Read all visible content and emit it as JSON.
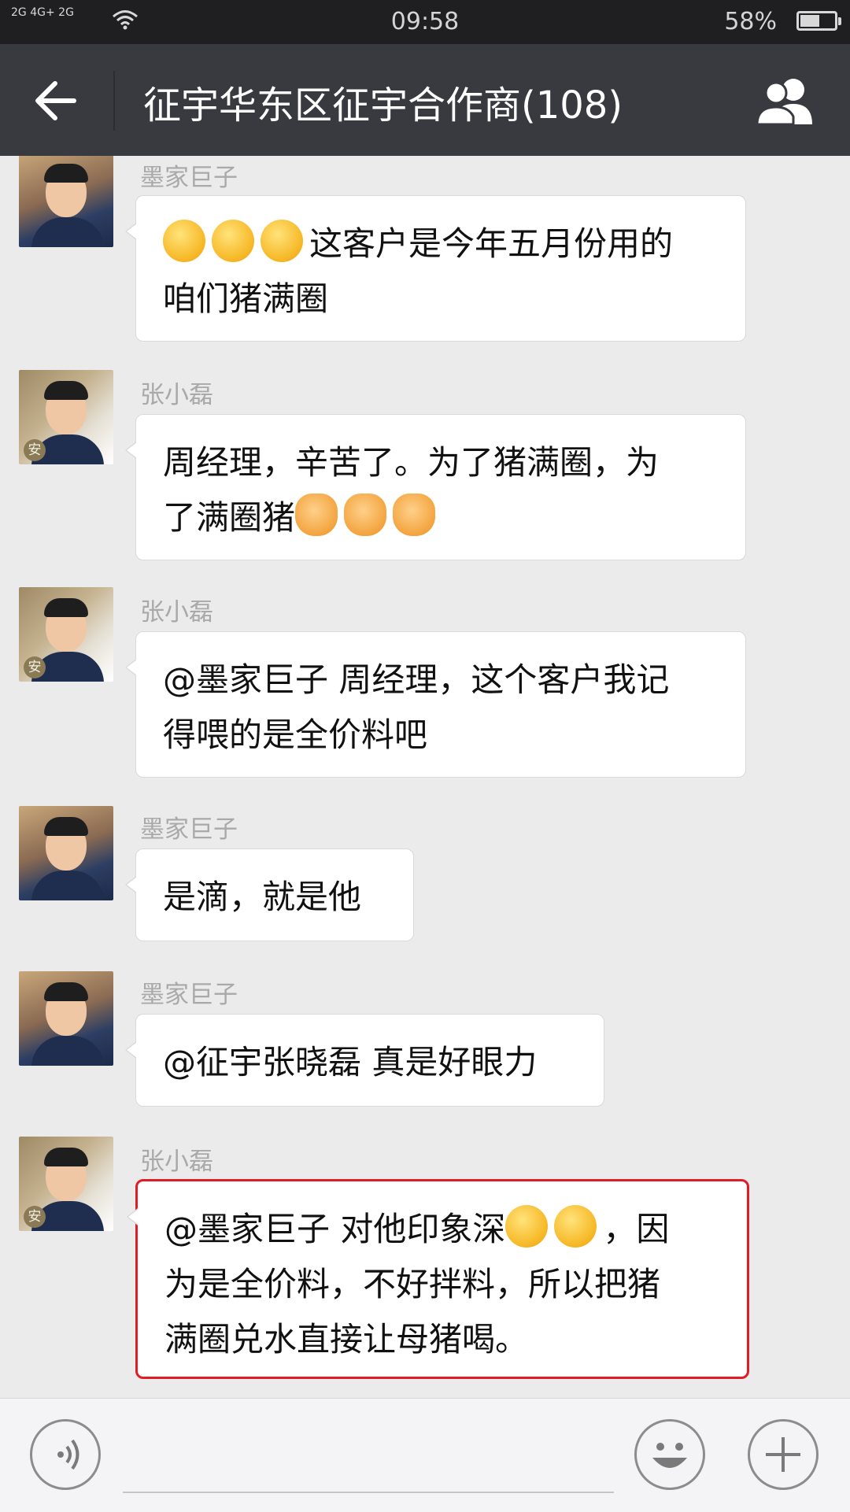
{
  "status_bar": {
    "network_1": "2G",
    "network_2": "4G+ 2G",
    "time": "09:58",
    "battery_percent": "58%",
    "battery_level": 0.58
  },
  "header": {
    "title": "征宇华东区征宇合作商(108)",
    "back_icon": "arrow-left-icon",
    "group_icon": "group-members-icon"
  },
  "messages": [
    {
      "sender": "墨家巨子",
      "text_line1_suffix": "这客户是今年五月份用的",
      "text_line2": "咱们猪满圈",
      "emojis": [
        "winking-tongue-emoji",
        "winking-tongue-emoji",
        "winking-tongue-emoji"
      ]
    },
    {
      "sender": "张小磊",
      "text_line1": "周经理，辛苦了。为了猪满圈，为",
      "text_line2_prefix": "了满圈猪",
      "emojis": [
        "fist-emoji",
        "fist-emoji",
        "fist-emoji"
      ]
    },
    {
      "sender": "张小磊",
      "text_line1": "@墨家巨子 周经理，这个客户我记",
      "text_line2": "得喂的是全价料吧"
    },
    {
      "sender": "墨家巨子",
      "text": "是滴，就是他"
    },
    {
      "sender": "墨家巨子",
      "text": "@征宇张晓磊 真是好眼力"
    },
    {
      "sender": "张小磊",
      "text_line1_prefix": "@墨家巨子 对他印象深",
      "text_line1_suffix": "，因",
      "text_line2": "为是全价料，不好拌料，所以把猪",
      "text_line3": "满圈兑水直接让母猪喝。",
      "emojis": [
        "grinning-emoji",
        "grinning-emoji"
      ]
    }
  ],
  "avatar_badge": "安",
  "input_bar": {
    "voice_icon": "voice-icon",
    "emoji_icon": "smiley-icon",
    "plus_icon": "plus-icon"
  },
  "colors": {
    "title_bar": "#393a3f",
    "chat_background": "#ebebeb",
    "highlight_border": "#e21b24"
  }
}
